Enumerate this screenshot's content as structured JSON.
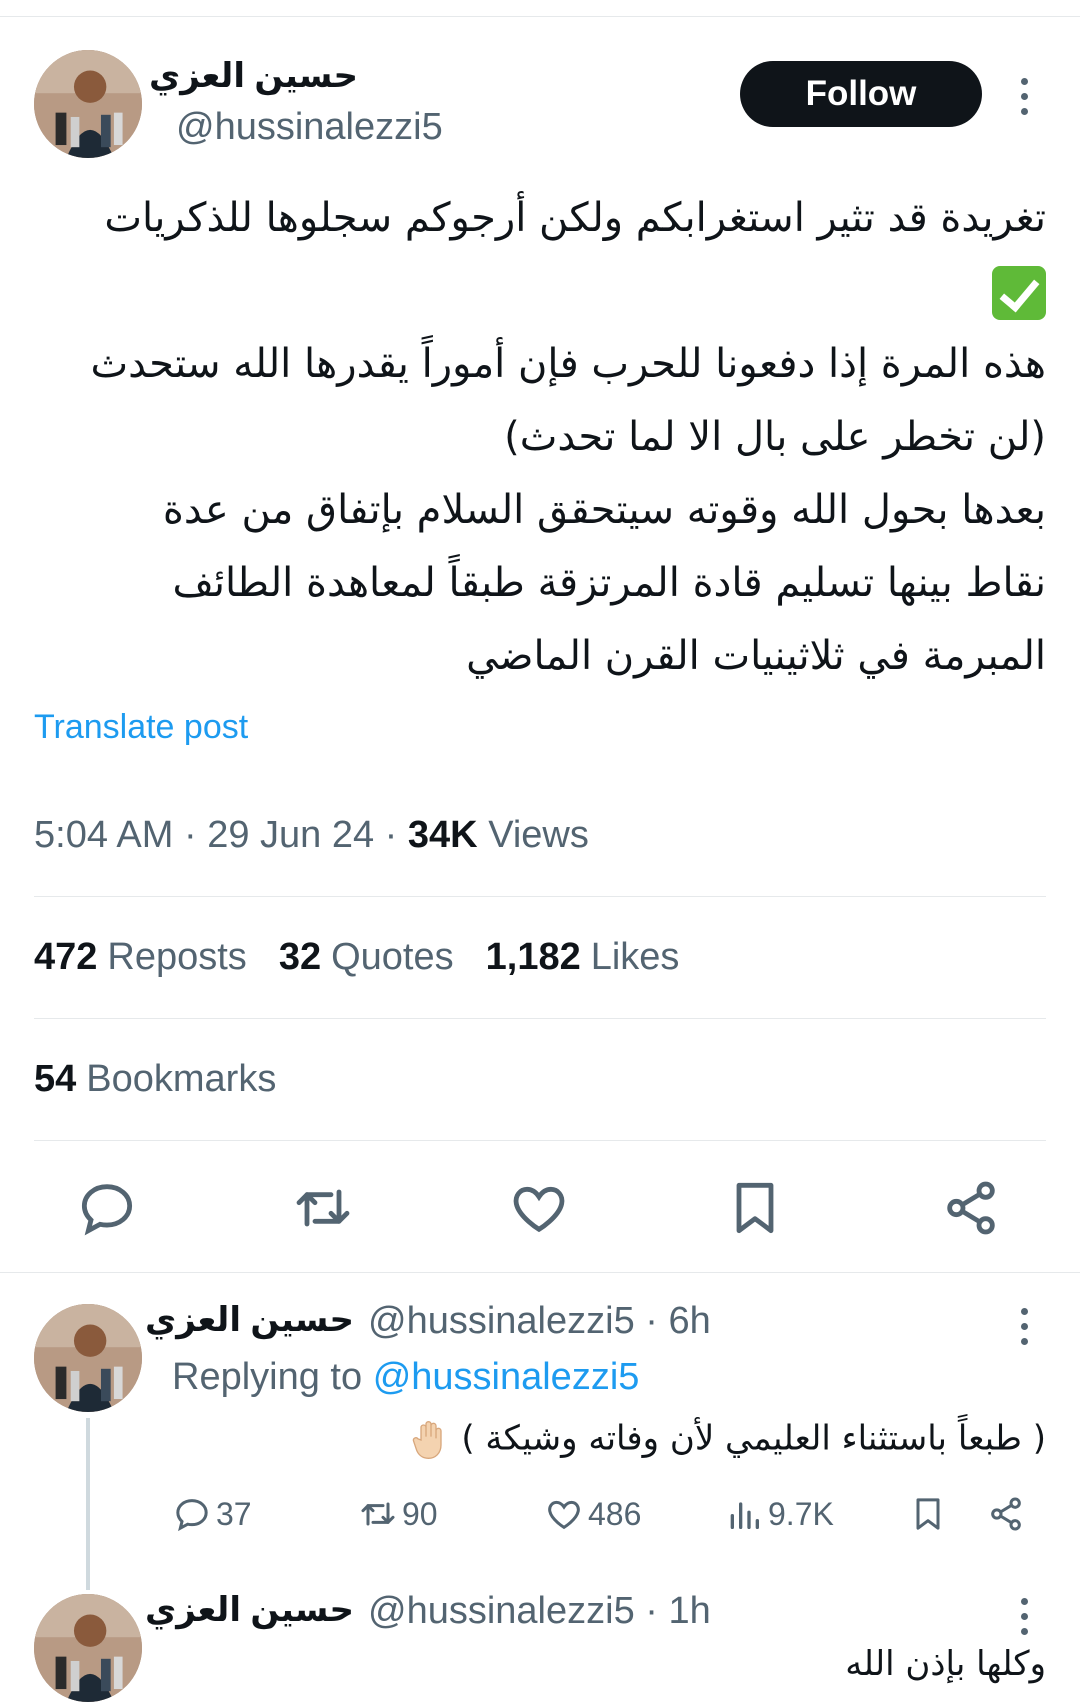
{
  "post": {
    "author_name": "حسين العزي",
    "author_handle": "@hussinalezzi5",
    "follow_label": "Follow",
    "text_lines": [
      "تغريدة قد تثير استغرابكم ولكن أرجوكم سجلوها للذكريات",
      "هذه المرة إذا دفعونا للحرب فإن أموراً يقدرها الله ستحدث",
      "(لن تخطر على بال الا لما تحدث)",
      "بعدها بحول الله وقوته سيتحقق السلام بإتفاق من عدة",
      "نقاط بينها تسليم قادة المرتزقة طبقاً لمعاهدة الطائف",
      "المبرمة في ثلاثينيات القرن الماضي"
    ],
    "translate_label": "Translate post",
    "time": "5:04 AM",
    "date": "29 Jun 24",
    "views_count": "34K",
    "views_label": "Views",
    "reposts_count": "472",
    "reposts_label": "Reposts",
    "quotes_count": "32",
    "quotes_label": "Quotes",
    "likes_count": "1,182",
    "likes_label": "Likes",
    "bookmarks_count": "54",
    "bookmarks_label": "Bookmarks"
  },
  "replies": [
    {
      "author_name": "حسين العزي",
      "author_handle": "@hussinalezzi5",
      "time_ago": "6h",
      "replying_label": "Replying to",
      "replying_handle": "@hussinalezzi5",
      "text": "( طبعاً باستثناء العليمي لأن وفاته وشيكة )",
      "reply_count": "37",
      "repost_count": "90",
      "like_count": "486",
      "view_count": "9.7K"
    },
    {
      "author_name": "حسين العزي",
      "author_handle": "@hussinalezzi5",
      "time_ago": "1h",
      "text": "وكلها بإذن الله"
    }
  ],
  "icons": {
    "check": "check-mark-emoji",
    "hand": "raised-hand-emoji"
  },
  "colors": {
    "accent": "#1d9bf0",
    "text": "#0f1419",
    "muted": "#536471",
    "divider": "#e6e9eb"
  }
}
